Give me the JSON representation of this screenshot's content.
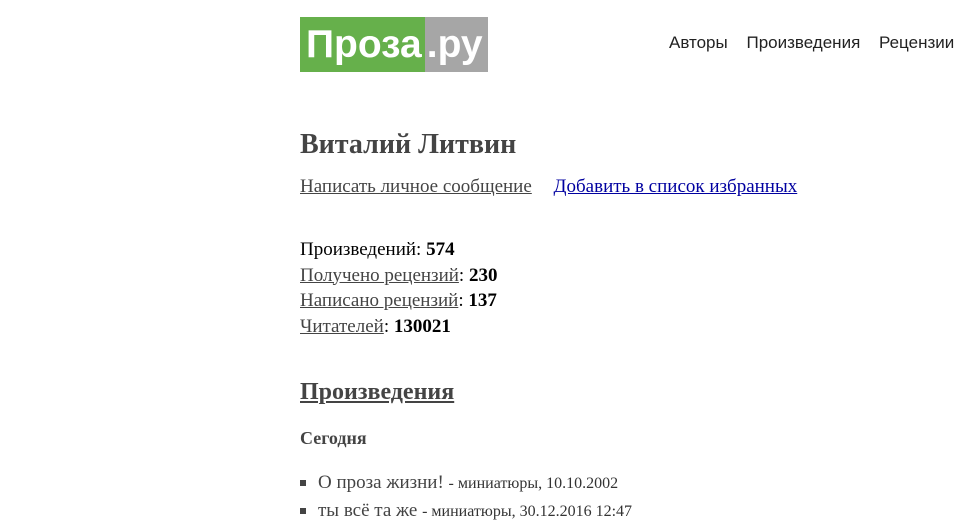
{
  "header": {
    "logo": {
      "main": "Проза",
      "tld": ".ру"
    },
    "nav": [
      "Авторы",
      "Произведения",
      "Рецензии"
    ]
  },
  "author": {
    "name": "Виталий Литвин",
    "message_link": "Написать личное сообщение",
    "favorites_link": "Добавить в список избранных"
  },
  "stats": {
    "works_label": "Произведений",
    "works_value": "574",
    "received_label": "Получено рецензий",
    "received_value": "230",
    "written_label": "Написано рецензий",
    "written_value": "137",
    "readers_label": "Читателей",
    "readers_value": "130021"
  },
  "works_section": {
    "title": "Произведения",
    "group_label": "Сегодня",
    "items": [
      {
        "title": "О проза жизни!",
        "meta": "- миниатюры, 10.10.2002"
      },
      {
        "title": "ты всё та же",
        "meta": "- миниатюры, 30.12.2016 12:47"
      }
    ]
  }
}
